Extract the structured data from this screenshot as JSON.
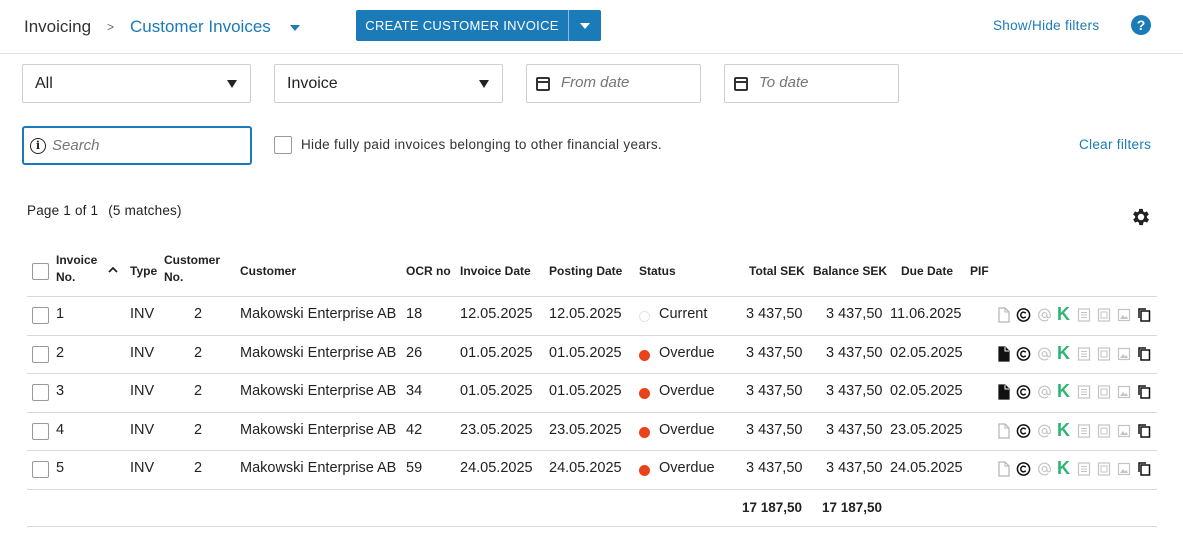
{
  "header": {
    "breadcrumb_root": "Invoicing",
    "breadcrumb_sep": ">",
    "breadcrumb_current": "Customer Invoices",
    "create_button": "CREATE CUSTOMER INVOICE",
    "show_hide_filters": "Show/Hide filters",
    "help": "?"
  },
  "filters": {
    "scope_select": "All",
    "type_select": "Invoice",
    "from_date_placeholder": "From date",
    "to_date_placeholder": "To date",
    "search_placeholder": "Search",
    "hide_paid_label": "Hide fully paid invoices belonging to other financial years.",
    "clear_filters": "Clear filters"
  },
  "pagination": {
    "page_info": "Page 1 of 1",
    "matches": "(5 matches)"
  },
  "table": {
    "columns": {
      "invoice_no_1": "Invoice",
      "invoice_no_2": "No.",
      "type": "Type",
      "customer_no_1": "Customer",
      "customer_no_2": "No.",
      "customer": "Customer",
      "ocr": "OCR no",
      "invoice_date": "Invoice Date",
      "posting_date": "Posting Date",
      "status": "Status",
      "total": "Total SEK",
      "balance": "Balance SEK",
      "due_date": "Due Date",
      "pif": "PIF"
    },
    "rows": [
      {
        "no": "1",
        "type": "INV",
        "customer_no": "2",
        "customer": "Makowski Enterprise AB",
        "ocr": "18",
        "invoice_date": "12.05.2025",
        "posting_date": "12.05.2025",
        "status": "Current",
        "total": "3 437,50",
        "balance": "3 437,50",
        "due_date": "11.06.2025"
      },
      {
        "no": "2",
        "type": "INV",
        "customer_no": "2",
        "customer": "Makowski Enterprise AB",
        "ocr": "26",
        "invoice_date": "01.05.2025",
        "posting_date": "01.05.2025",
        "status": "Overdue",
        "total": "3 437,50",
        "balance": "3 437,50",
        "due_date": "02.05.2025"
      },
      {
        "no": "3",
        "type": "INV",
        "customer_no": "2",
        "customer": "Makowski Enterprise AB",
        "ocr": "34",
        "invoice_date": "01.05.2025",
        "posting_date": "01.05.2025",
        "status": "Overdue",
        "total": "3 437,50",
        "balance": "3 437,50",
        "due_date": "02.05.2025"
      },
      {
        "no": "4",
        "type": "INV",
        "customer_no": "2",
        "customer": "Makowski Enterprise AB",
        "ocr": "42",
        "invoice_date": "23.05.2025",
        "posting_date": "23.05.2025",
        "status": "Overdue",
        "total": "3 437,50",
        "balance": "3 437,50",
        "due_date": "23.05.2025"
      },
      {
        "no": "5",
        "type": "INV",
        "customer_no": "2",
        "customer": "Makowski Enterprise AB",
        "ocr": "59",
        "invoice_date": "24.05.2025",
        "posting_date": "24.05.2025",
        "status": "Overdue",
        "total": "3 437,50",
        "balance": "3 437,50",
        "due_date": "24.05.2025"
      }
    ],
    "totals": {
      "total": "17 187,50",
      "balance": "17 187,50"
    }
  },
  "row_icon_letter": "K",
  "colors": {
    "accent": "#1b7ab8",
    "overdue": "#e8431b",
    "current": "#ffffff",
    "kivra_green": "#2bb673"
  }
}
